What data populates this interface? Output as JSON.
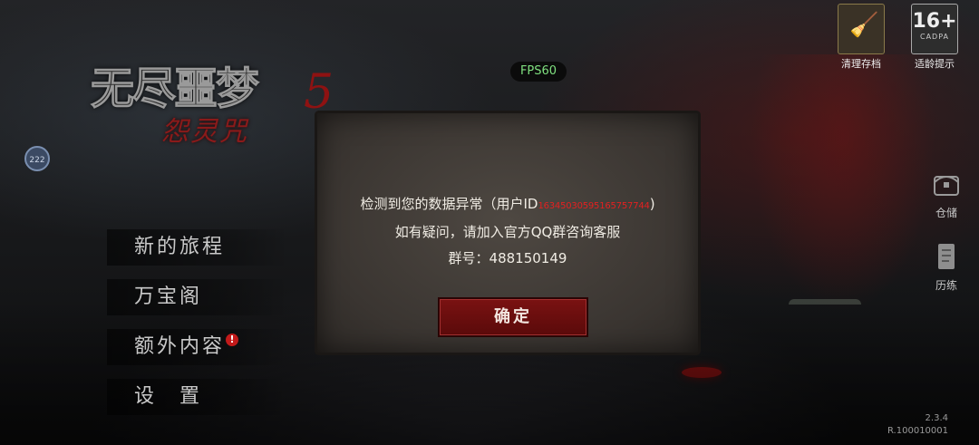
{
  "game": {
    "logo_title": "无尽噩梦",
    "logo_number": "5",
    "logo_subtitle": "怨灵咒"
  },
  "hud": {
    "fps": "FPS60",
    "float_button": "222",
    "clean_label": "清理存档",
    "age_rating": "16+",
    "age_caption": "CADPA",
    "age_label": "适龄提示"
  },
  "side_menu": {
    "warehouse": "仓储",
    "history": "历练"
  },
  "main_menu": {
    "items": [
      {
        "label": "新的旅程"
      },
      {
        "label": "万宝阁"
      },
      {
        "label": "额外内容",
        "badge": "!"
      },
      {
        "label": "设　置"
      }
    ]
  },
  "dialog": {
    "line1_prefix": "检测到您的数据异常（用户ID",
    "user_id": "16345030595165757744",
    "line1_suffix": ")",
    "line2": "如有疑问，请加入官方QQ群咨询客服",
    "line3": "群号：488150149",
    "confirm": "确定"
  },
  "version": {
    "number": "2.3.4",
    "build": "R.100010001"
  },
  "colors": {
    "fps_text": "#7fe07f",
    "uid_text": "#e32020",
    "button_red": "#7a1212",
    "logo_red": "#8e1212"
  }
}
